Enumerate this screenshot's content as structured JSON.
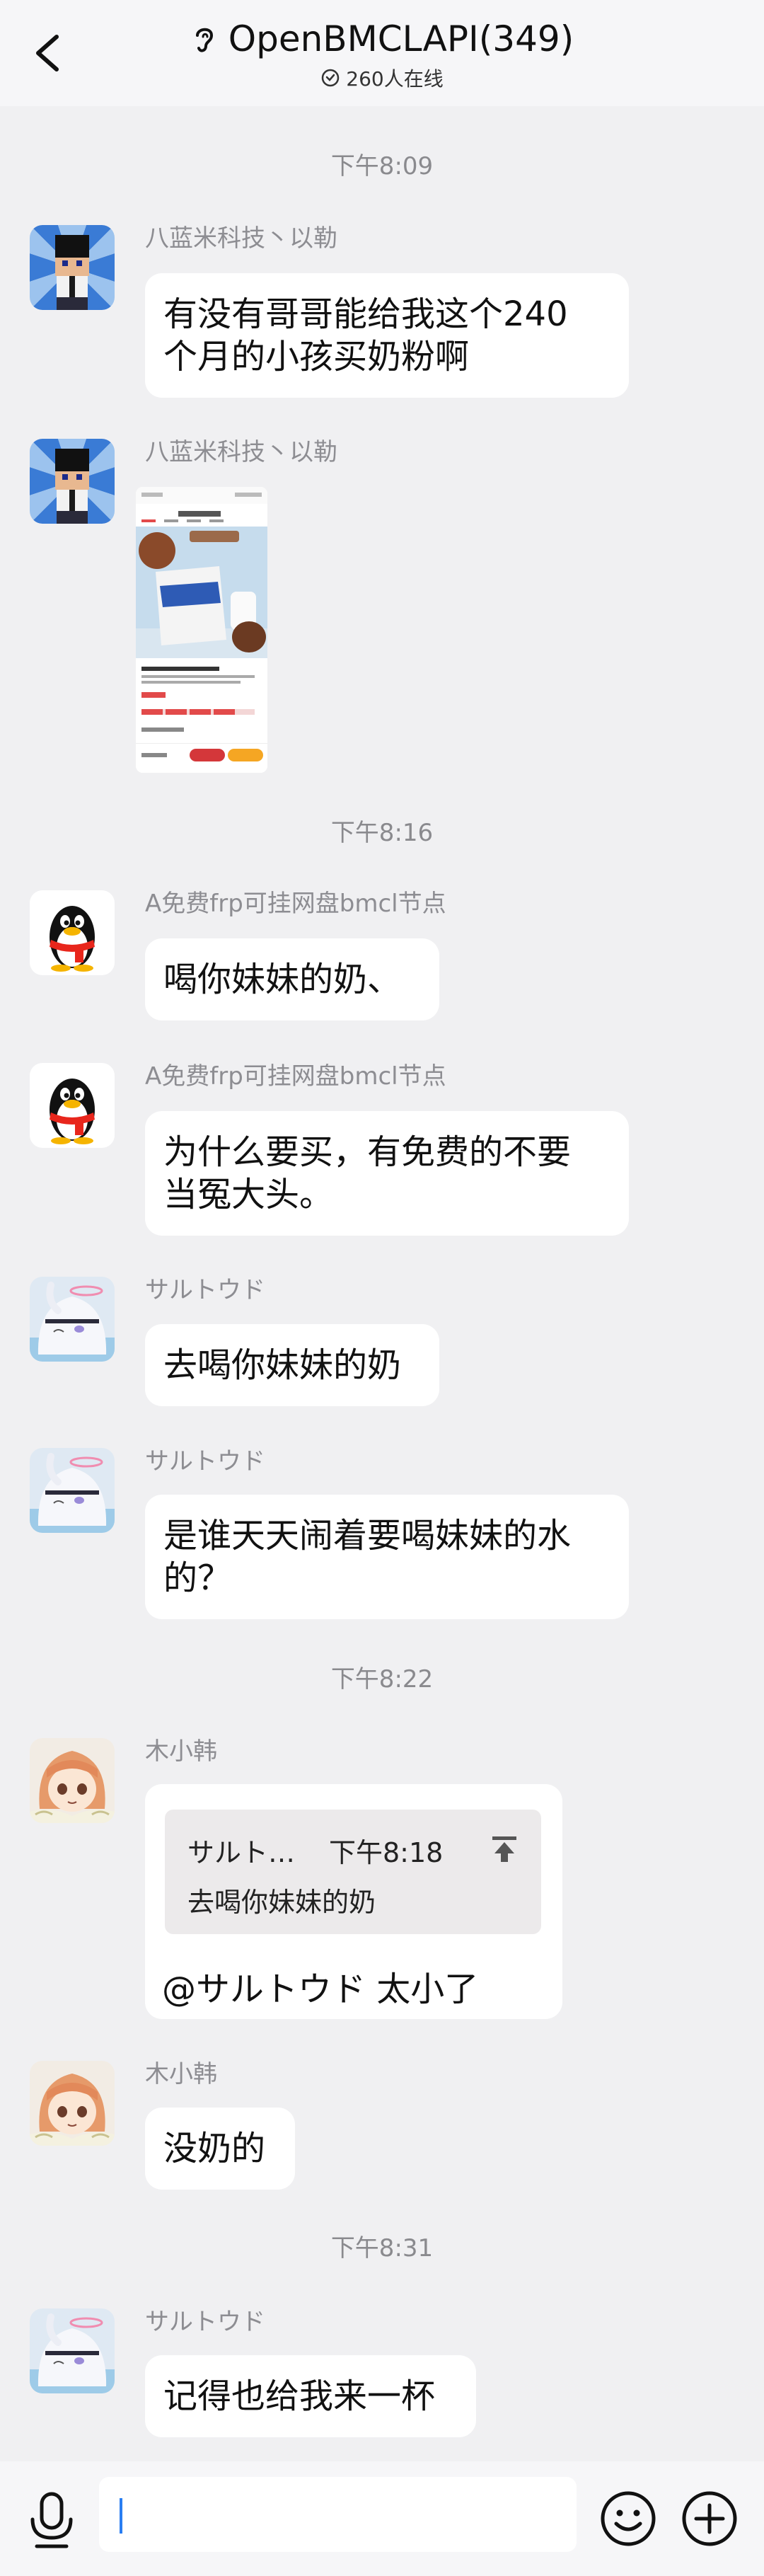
{
  "header": {
    "title": "OpenBMCLAPI(349)",
    "online_count": "260人在线"
  },
  "messages": [
    {
      "time": "下午8:09"
    },
    {
      "sender": "八蓝米科技丶以勒",
      "avatar": "pixel-character-avatar",
      "lines": [
        "有没有哥哥能给我这个240",
        "个月的小孩买奶粉啊"
      ]
    },
    {
      "sender": "八蓝米科技丶以勒",
      "avatar": "pixel-character-avatar",
      "image": "milk-powder-product-screenshot"
    },
    {
      "time": "下午8:16"
    },
    {
      "sender": "A免费frp可挂网盘bmcl节点",
      "avatar": "qq-penguin-avatar",
      "lines": [
        "喝你妹妹的奶、"
      ]
    },
    {
      "sender": "A免费frp可挂网盘bmcl节点",
      "avatar": "qq-penguin-avatar",
      "lines": [
        "为什么要买，有免费的不要",
        "当冤大头。"
      ]
    },
    {
      "sender": "サルトウド",
      "avatar": "anime-halo-girl-avatar",
      "lines": [
        "去喝你妹妹的奶"
      ]
    },
    {
      "sender": "サルトウド",
      "avatar": "anime-halo-girl-avatar",
      "lines": [
        "是谁天天闹着要喝妹妹的水",
        "的？"
      ]
    },
    {
      "time": "下午8:22"
    },
    {
      "sender": "木小韩",
      "avatar": "anime-orange-hair-avatar",
      "quote": {
        "author": "サルト…",
        "time": "下午8:18",
        "text": "去喝你妹妹的奶"
      },
      "lines": [
        "@サルトウド 太小了"
      ]
    },
    {
      "sender": "木小韩",
      "avatar": "anime-orange-hair-avatar",
      "lines": [
        "没奶的"
      ]
    },
    {
      "time": "下午8:31"
    },
    {
      "sender": "サルトウド",
      "avatar": "anime-halo-girl-avatar",
      "lines": [
        "记得也给我来一杯"
      ]
    }
  ],
  "input": {
    "value": "",
    "icons": [
      "voice-icon",
      "emoji-icon",
      "plus-icon"
    ]
  },
  "colors": {
    "background": "#f0f0f2",
    "bubble": "#ffffff",
    "caret": "#2a7ef2",
    "meta_text": "#8d8d92"
  }
}
